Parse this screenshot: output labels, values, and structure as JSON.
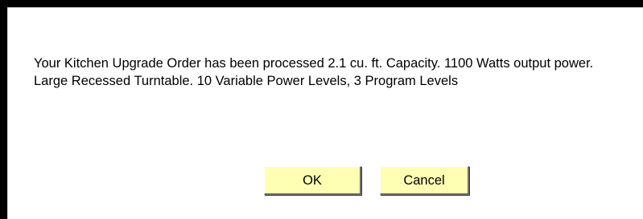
{
  "dialog": {
    "message": "Your Kitchen Upgrade Order has been processed 2.1 cu. ft. Capacity. 1100 Watts output power. Large Recessed Turntable. 10 Variable Power Levels, 3 Program Levels",
    "ok_label": "OK",
    "cancel_label": "Cancel"
  },
  "colors": {
    "button_background": "#ffffb4",
    "frame_edge": "#000000",
    "dialog_background": "#ffffff"
  }
}
